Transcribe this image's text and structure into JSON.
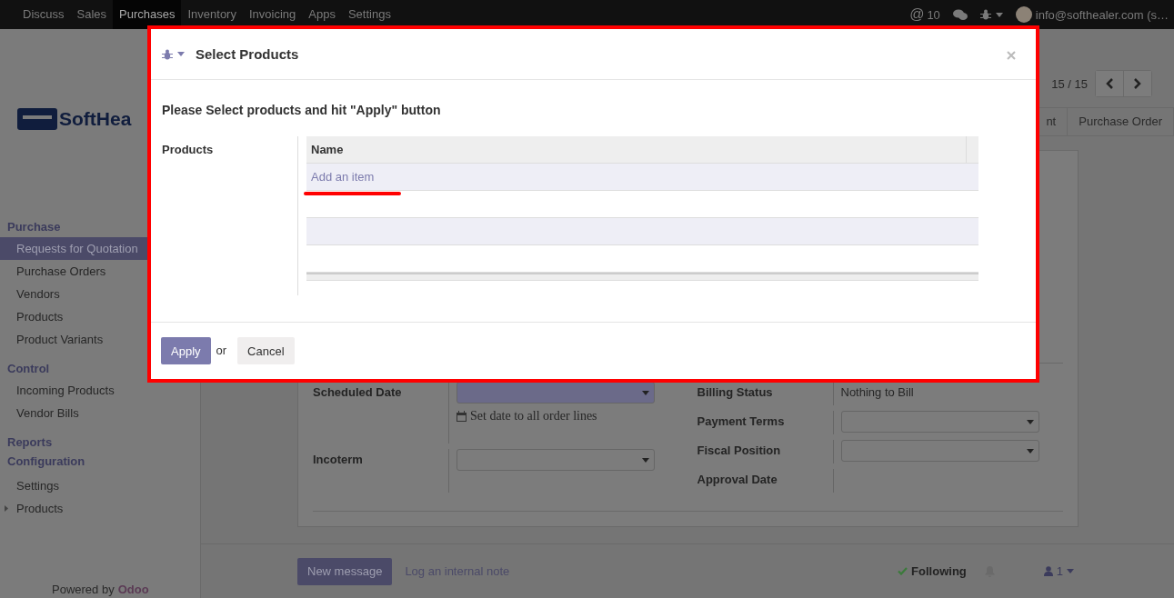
{
  "topbar": {
    "apps": [
      {
        "label": "Discuss",
        "selected": false
      },
      {
        "label": "Sales",
        "selected": false
      },
      {
        "label": "Purchases",
        "selected": true
      },
      {
        "label": "Inventory",
        "selected": false
      },
      {
        "label": "Invoicing",
        "selected": false
      },
      {
        "label": "Apps",
        "selected": false
      },
      {
        "label": "Settings",
        "selected": false
      }
    ],
    "mention_sign": "@",
    "mention_count": "10",
    "user": "info@softhealer.com (s…"
  },
  "sidebar": {
    "logo_text": "SoftHea",
    "sections": [
      {
        "title": "Purchase",
        "items": [
          {
            "label": "Requests for Quotation",
            "selected": true,
            "kind": "link"
          },
          {
            "label": "Purchase Orders",
            "selected": false,
            "kind": "link"
          },
          {
            "label": "Vendors",
            "selected": false,
            "kind": "link"
          },
          {
            "label": "Products",
            "selected": false,
            "kind": "link"
          },
          {
            "label": "Product Variants",
            "selected": false,
            "kind": "link"
          }
        ]
      },
      {
        "title": "Control",
        "items": [
          {
            "label": "Incoming Products",
            "selected": false,
            "kind": "link"
          },
          {
            "label": "Vendor Bills",
            "selected": false,
            "kind": "link"
          }
        ]
      },
      {
        "title": "Reports"
      },
      {
        "title": "Configuration",
        "items": [
          {
            "label": "Settings",
            "selected": false,
            "kind": "link"
          },
          {
            "label": "Products",
            "selected": false,
            "kind": "folder"
          }
        ]
      }
    ],
    "powered": "Powered by",
    "brand": "Odoo"
  },
  "control_panel": {
    "pager": "15 / 15",
    "status_steps": [
      "nt",
      "Purchase Order"
    ]
  },
  "form": {
    "left": [
      {
        "label": "Scheduled Date",
        "kind": "select",
        "required": true,
        "note": "Set date to all order lines"
      },
      {
        "label": "Incoterm",
        "kind": "select",
        "required": false
      }
    ],
    "right": [
      {
        "label": "Billing Status",
        "kind": "text",
        "value": "Nothing to Bill"
      },
      {
        "label": "Payment Terms",
        "kind": "select",
        "required": false
      },
      {
        "label": "Fiscal Position",
        "kind": "select",
        "required": false
      },
      {
        "label": "Approval Date",
        "kind": "text"
      }
    ]
  },
  "chatter": {
    "new_message": "New message",
    "log_note": "Log an internal note",
    "following": "Following",
    "followers": "1"
  },
  "dialog": {
    "title": "Select Products",
    "heading": "Please Select products and hit \"Apply\" button",
    "field_label": "Products",
    "column": "Name",
    "add_item": "Add an item",
    "apply": "Apply",
    "or": "or",
    "cancel": "Cancel"
  }
}
